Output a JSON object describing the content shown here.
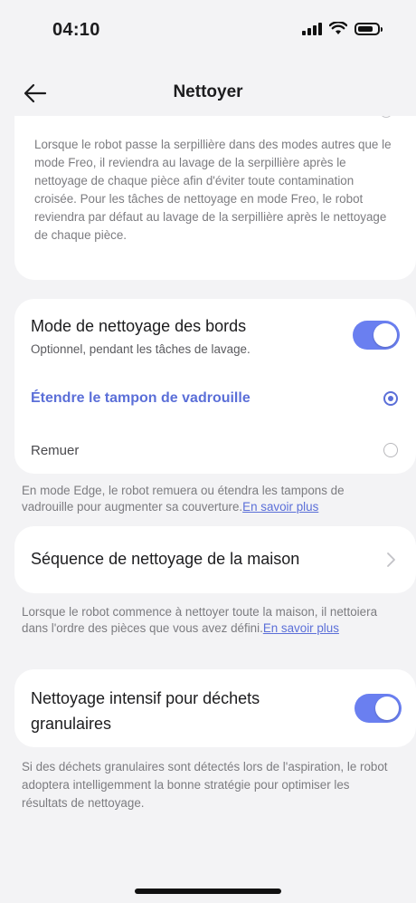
{
  "status_bar": {
    "time": "04:10"
  },
  "header": {
    "title": "Nettoyer"
  },
  "mop_wash": {
    "description": "Lorsque le robot passe la serpillière dans des modes autres que le mode Freo, il reviendra au lavage de la serpillière après le nettoyage de chaque pièce afin d'éviter toute contamination croisée. Pour les tâches de nettoyage en mode Freo, le robot reviendra par défaut au lavage de la serpillière après le nettoyage de chaque pièce."
  },
  "edge_mode": {
    "title": "Mode de nettoyage des bords",
    "subtitle": "Optionnel, pendant les tâches de lavage.",
    "toggle_on": true,
    "options": [
      {
        "label": "Étendre le tampon de vadrouille",
        "selected": true
      },
      {
        "label": "Remuer",
        "selected": false
      }
    ],
    "note": "En mode Edge, le robot remuera ou étendra les tampons de vadrouille pour augmenter sa couverture.",
    "link": "En savoir plus"
  },
  "sequence": {
    "title": "Séquence de nettoyage de la maison",
    "note": "Lorsque le robot commence à nettoyer toute la maison, il nettoiera dans l'ordre des pièces que vous avez défini.",
    "link": "En savoir plus"
  },
  "granular": {
    "title": "Nettoyage intensif pour déchets granulaires",
    "toggle_on": true,
    "note": "Si des déchets granulaires sont détectés lors de l'aspiration, le robot adoptera intelligemment la bonne stratégie pour optimiser les résultats de nettoyage."
  },
  "colors": {
    "accent": "#5b6fd8",
    "toggle": "#6a7ff0",
    "background": "#f3f3f5"
  }
}
